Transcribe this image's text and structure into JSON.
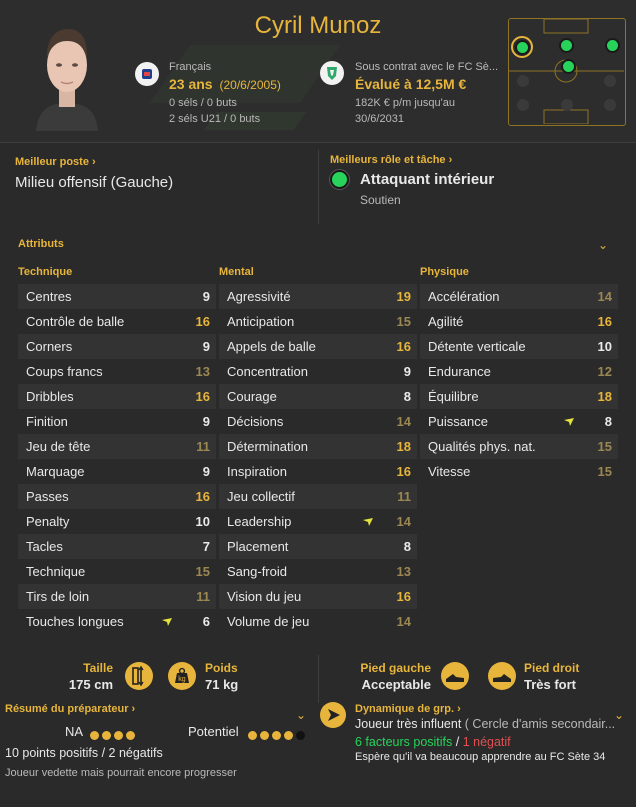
{
  "player": {
    "name": "Cyril Munoz",
    "nationality": "Français",
    "age": "23 ans",
    "dob": "(20/6/2005)",
    "caps_senior": "0 séls / 0 buts",
    "caps_u21": "2 séls U21 / 0 buts",
    "contract_label": "Sous contrat avec le FC Sè...",
    "value": "Évalué à 12,5M €",
    "wage": "182K € p/m jusqu'au",
    "contract_end": "30/6/2031"
  },
  "best_position": {
    "label": "Meilleur poste",
    "value": "Milieu offensif (Gauche)"
  },
  "best_role": {
    "label": "Meilleurs rôle et tâche",
    "role": "Attaquant intérieur",
    "duty": "Soutien"
  },
  "attributes": {
    "title": "Attributs",
    "technical": {
      "title": "Technique",
      "rows": [
        {
          "name": "Centres",
          "value": "9",
          "tone": "white"
        },
        {
          "name": "Contrôle de balle",
          "value": "16",
          "tone": "gold"
        },
        {
          "name": "Corners",
          "value": "9",
          "tone": "white"
        },
        {
          "name": "Coups francs",
          "value": "13",
          "tone": "dim"
        },
        {
          "name": "Dribbles",
          "value": "16",
          "tone": "gold"
        },
        {
          "name": "Finition",
          "value": "9",
          "tone": "white"
        },
        {
          "name": "Jeu de tête",
          "value": "11",
          "tone": "dim"
        },
        {
          "name": "Marquage",
          "value": "9",
          "tone": "white"
        },
        {
          "name": "Passes",
          "value": "16",
          "tone": "gold"
        },
        {
          "name": "Penalty",
          "value": "10",
          "tone": "white"
        },
        {
          "name": "Tacles",
          "value": "7",
          "tone": "white"
        },
        {
          "name": "Technique",
          "value": "15",
          "tone": "dim"
        },
        {
          "name": "Tirs de loin",
          "value": "11",
          "tone": "dim"
        },
        {
          "name": "Touches longues",
          "value": "6",
          "tone": "white",
          "trend": true
        }
      ]
    },
    "mental": {
      "title": "Mental",
      "rows": [
        {
          "name": "Agressivité",
          "value": "19",
          "tone": "gold"
        },
        {
          "name": "Anticipation",
          "value": "15",
          "tone": "dim"
        },
        {
          "name": "Appels de balle",
          "value": "16",
          "tone": "gold"
        },
        {
          "name": "Concentration",
          "value": "9",
          "tone": "white"
        },
        {
          "name": "Courage",
          "value": "8",
          "tone": "white"
        },
        {
          "name": "Décisions",
          "value": "14",
          "tone": "dim"
        },
        {
          "name": "Détermination",
          "value": "18",
          "tone": "gold"
        },
        {
          "name": "Inspiration",
          "value": "16",
          "tone": "gold"
        },
        {
          "name": "Jeu collectif",
          "value": "11",
          "tone": "dim"
        },
        {
          "name": "Leadership",
          "value": "14",
          "tone": "dim",
          "trend": true
        },
        {
          "name": "Placement",
          "value": "8",
          "tone": "white"
        },
        {
          "name": "Sang-froid",
          "value": "13",
          "tone": "dim"
        },
        {
          "name": "Vision du jeu",
          "value": "16",
          "tone": "gold"
        },
        {
          "name": "Volume de jeu",
          "value": "14",
          "tone": "dim"
        }
      ]
    },
    "physical": {
      "title": "Physique",
      "rows": [
        {
          "name": "Accélération",
          "value": "14",
          "tone": "dim"
        },
        {
          "name": "Agilité",
          "value": "16",
          "tone": "gold"
        },
        {
          "name": "Détente verticale",
          "value": "10",
          "tone": "white"
        },
        {
          "name": "Endurance",
          "value": "12",
          "tone": "dim"
        },
        {
          "name": "Équilibre",
          "value": "18",
          "tone": "gold"
        },
        {
          "name": "Puissance",
          "value": "8",
          "tone": "white",
          "trend": true
        },
        {
          "name": "Qualités phys. nat.",
          "value": "15",
          "tone": "dim"
        },
        {
          "name": "Vitesse",
          "value": "15",
          "tone": "dim"
        }
      ]
    }
  },
  "bio": {
    "height_label": "Taille",
    "height": "175 cm",
    "weight_label": "Poids",
    "weight": "71 kg",
    "left_foot_label": "Pied gauche",
    "left_foot": "Acceptable",
    "right_foot_label": "Pied droit",
    "right_foot": "Très fort"
  },
  "coach": {
    "title": "Résumé du préparateur",
    "na_label": "NA",
    "na_stars": 4,
    "potential_label": "Potentiel",
    "potential_stars": 4,
    "stars_total": 5,
    "summary": "10 points positifs / 2 négatifs",
    "note": "Joueur vedette mais pourrait encore progresser"
  },
  "dynamics": {
    "title": "Dynamique de grp.",
    "influence": "Joueur très influent",
    "circle": "( Cercle d'amis secondair...",
    "positives": "6 facteurs positifs",
    "separator": " / ",
    "negatives": "1 négatif",
    "expectation": "Espère qu'il va beaucoup apprendre au FC Sète 34"
  },
  "colors": {
    "accent": "#e7b53b",
    "positive": "#27d35a",
    "negative": "#e25050"
  }
}
